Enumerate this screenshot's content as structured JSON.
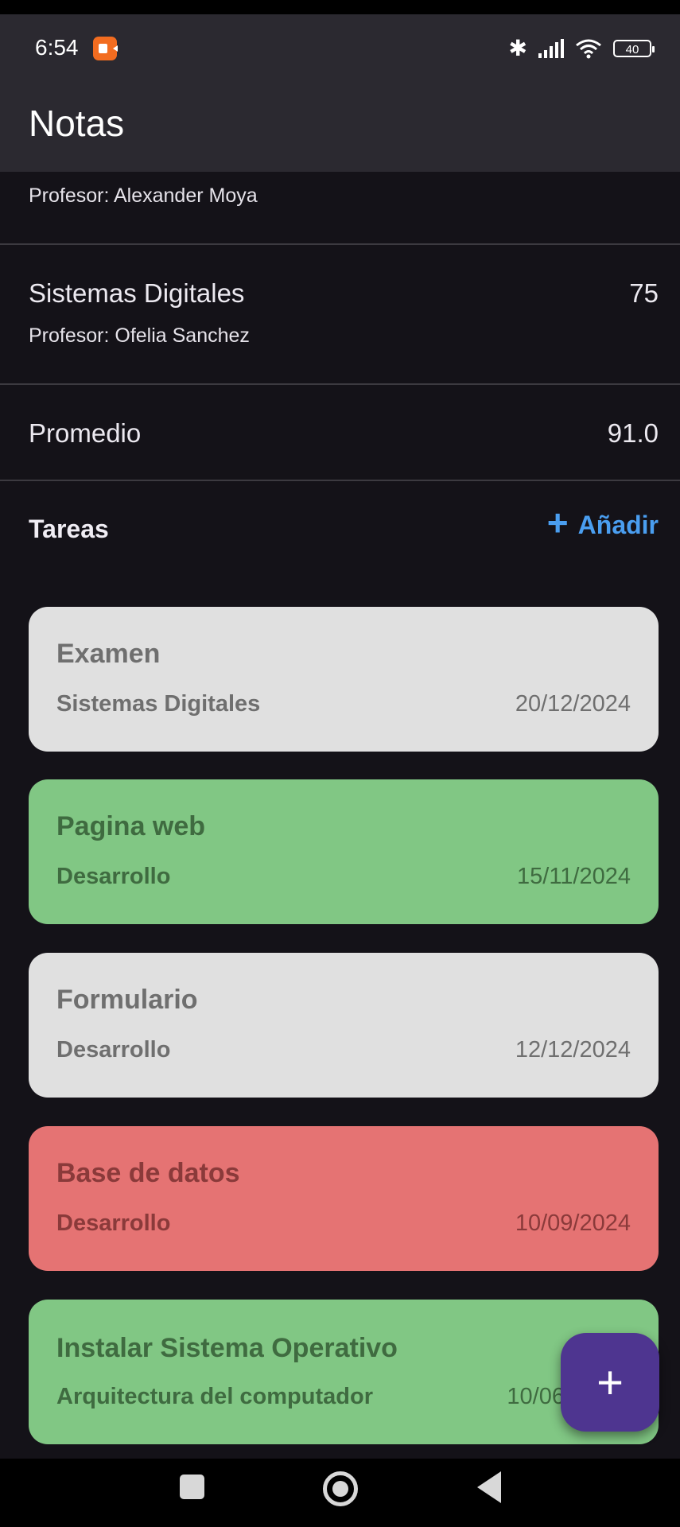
{
  "status_bar": {
    "time": "6:54",
    "battery": "40"
  },
  "app_bar": {
    "title": "Notas"
  },
  "subjects": [
    {
      "name": "",
      "professor": "Profesor: Alexander Moya",
      "grade": ""
    },
    {
      "name": "Sistemas Digitales",
      "professor": "Profesor: Ofelia Sanchez",
      "grade": "75"
    }
  ],
  "average": {
    "label": "Promedio",
    "value": "91.0"
  },
  "tasks_section": {
    "title": "Tareas",
    "add_label": "Añadir"
  },
  "tasks": [
    {
      "title": "Examen",
      "subject": "Sistemas Digitales",
      "date": "20/12/2024",
      "color": "#e0e0e0"
    },
    {
      "title": "Pagina web",
      "subject": "Desarrollo",
      "date": "15/11/2024",
      "color": "#81c784"
    },
    {
      "title": "Formulario",
      "subject": "Desarrollo",
      "date": "12/12/2024",
      "color": "#e0e0e0"
    },
    {
      "title": "Base de datos",
      "subject": "Desarrollo",
      "date": "10/09/2024",
      "color": "#e57373"
    },
    {
      "title": "Instalar Sistema Operativo",
      "subject": "Arquitectura del computador",
      "date": "10/06",
      "color": "#81c784"
    }
  ],
  "fab": {
    "label": "+"
  },
  "colors": {
    "accent": "#4a9ef0",
    "fab": "#4e3590",
    "background": "#141218",
    "app_bar": "#2b2930"
  }
}
